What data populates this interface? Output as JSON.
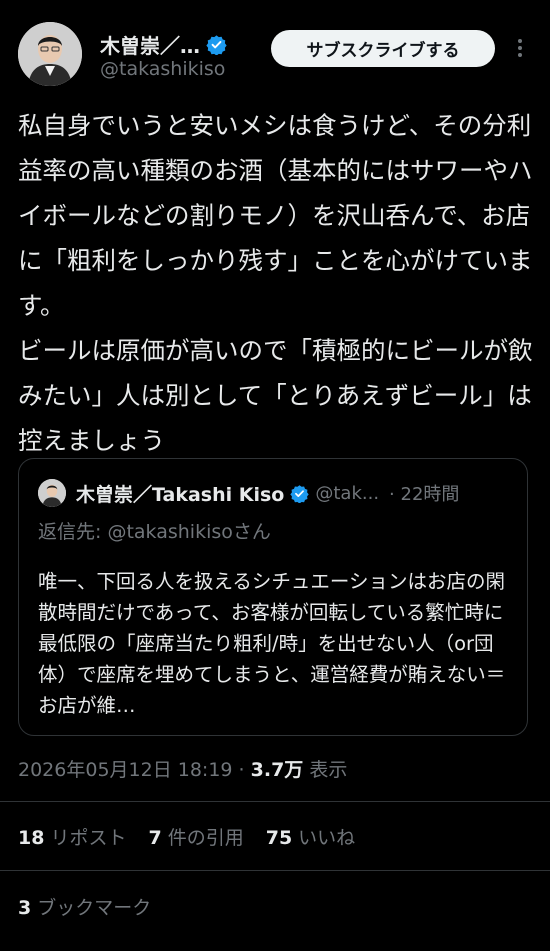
{
  "author": {
    "name": "木曽崇／…",
    "handle": "@takashikiso",
    "subscribe_label": "サブスクライブする"
  },
  "tweet_text": "私自身でいうと安いメシは食うけど、その分利益率の高い種類のお酒（基本的にはサワーやハイボールなどの割りモノ）を沢山呑んで、お店に「粗利をしっかり残す」ことを心がけています。\nビールは原価が高いので「積極的にビールが飲みたい」人は別として「とりあえずビール」は控えましょう",
  "quote": {
    "name": "木曽崇／Takashi Kiso",
    "handle": "@tak...",
    "time": "· 22時間",
    "reply_prefix": "返信先:",
    "reply_handle": "@takashikisoさん",
    "text": "唯一、下回る人を扱えるシチュエーションはお店の閑散時間だけであって、お客様が回転している繁忙時に最低限の「座席当たり粗利/時」を出せない人（or団体）で座席を埋めてしまうと、運営経費が賄えない＝お店が維…"
  },
  "meta": {
    "timestamp": "2026年05月12日 18:19 · ",
    "views": "3.7万",
    "views_label": " 表示"
  },
  "stats": {
    "reposts": "18",
    "reposts_label": "リポスト",
    "quotes": "7",
    "quotes_label": "件の引用",
    "likes": "75",
    "likes_label": "いいね",
    "bookmarks": "3",
    "bookmarks_label": "ブックマーク"
  },
  "colors": {
    "verified": "#1d9bf0",
    "background": "#000000",
    "muted": "#71767b"
  }
}
